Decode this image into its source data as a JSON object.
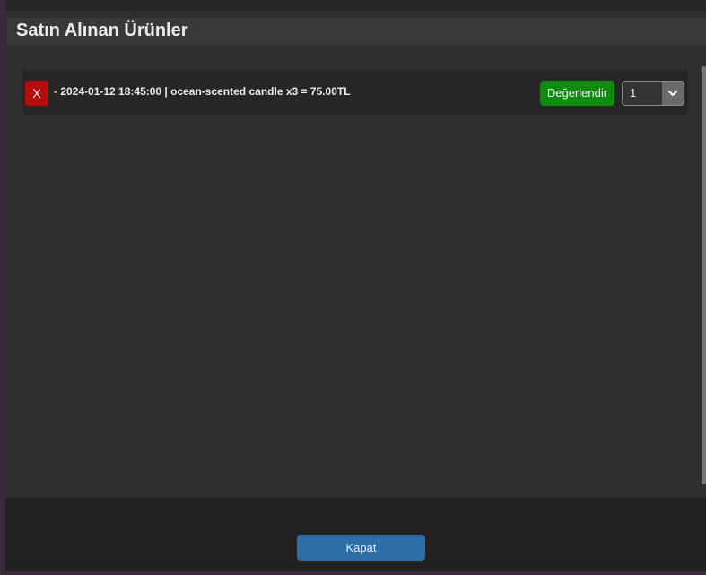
{
  "dialog": {
    "title": "Satın Alınan Ürünler"
  },
  "purchases": [
    {
      "remove_label": "X",
      "text": "- 2024-01-12 18:45:00 | ocean-scented candle x3 = 75.00TL",
      "rate_label": "Değerlendir",
      "rating_value": "1"
    }
  ],
  "footer": {
    "close_label": "Kapat"
  },
  "icons": {
    "rating_dropdown": "chevron-down-icon"
  },
  "colors": {
    "remove": "#b80c0c",
    "rate": "#0f8a0f",
    "close": "#2c6ea8"
  }
}
